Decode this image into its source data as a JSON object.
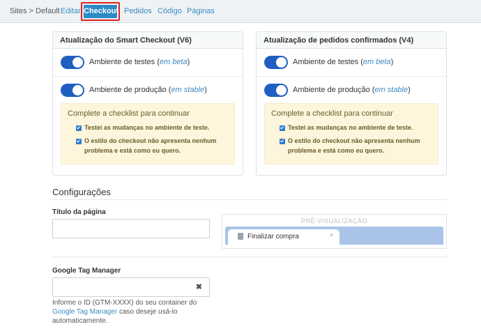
{
  "nav": {
    "breadcrumb": "Sites > Default",
    "tabs": [
      {
        "label": "Editar"
      },
      {
        "label": "Checkout"
      },
      {
        "label": "Pedidos"
      },
      {
        "label": "Código"
      },
      {
        "label": "Páginas"
      }
    ],
    "active_tab": "Checkout"
  },
  "cards": [
    {
      "title": "Atualização do Smart Checkout (V6)",
      "toggles": [
        {
          "label": "Ambiente de testes (",
          "tag": "em beta",
          "suffix": ")",
          "on": true
        },
        {
          "label": "Ambiente de produção (",
          "tag": "em stable",
          "suffix": ")",
          "on": true
        }
      ],
      "checklist": {
        "title": "Complete a checklist para continuar",
        "items": [
          {
            "text": "Testei as mudanças no ambiente de teste.",
            "checked": true
          },
          {
            "text": "O estilo do checkout não apresenta nenhum problema e está como eu quero.",
            "checked": true
          }
        ]
      }
    },
    {
      "title": "Atualização de pedidos confirmados (V4)",
      "toggles": [
        {
          "label": "Ambiente de testes (",
          "tag": "em beta",
          "suffix": ")",
          "on": true
        },
        {
          "label": "Ambiente de produção (",
          "tag": "em stable",
          "suffix": ")",
          "on": true
        }
      ],
      "checklist": {
        "title": "Complete a checklist para continuar",
        "items": [
          {
            "text": "Testei as mudanças no ambiente de teste.",
            "checked": true
          },
          {
            "text": "O estilo do checkout não apresenta nenhum problema e está como eu quero.",
            "checked": true
          }
        ]
      }
    }
  ],
  "settings": {
    "title": "Configurações",
    "page_title_label": "Título da página",
    "page_title_value": "",
    "preview": {
      "title": "PRÉ-VISUALIZAÇÃO",
      "tab_label": "Finalizar compra",
      "tab_close": "×"
    },
    "gtm_label": "Google Tag Manager",
    "gtm_value": "",
    "gtm_clear": "✖",
    "help_prefix": "Informe o ID (GTM-XXXX) do seu container do ",
    "help_link": "Google Tag Manager",
    "help_suffix": " caso deseje usá-lo automaticamente."
  },
  "colors": {
    "accent": "#2c8ac8",
    "toggle_on": "#1f5fc2",
    "active_tab_outline": "#e02020",
    "checklist_bg": "#fdf6dc",
    "link": "#3b8ac0"
  },
  "icons": {
    "toggle": "toggle-switch",
    "check": "checkbox-checked",
    "page": "document-icon",
    "clear": "close-icon"
  }
}
